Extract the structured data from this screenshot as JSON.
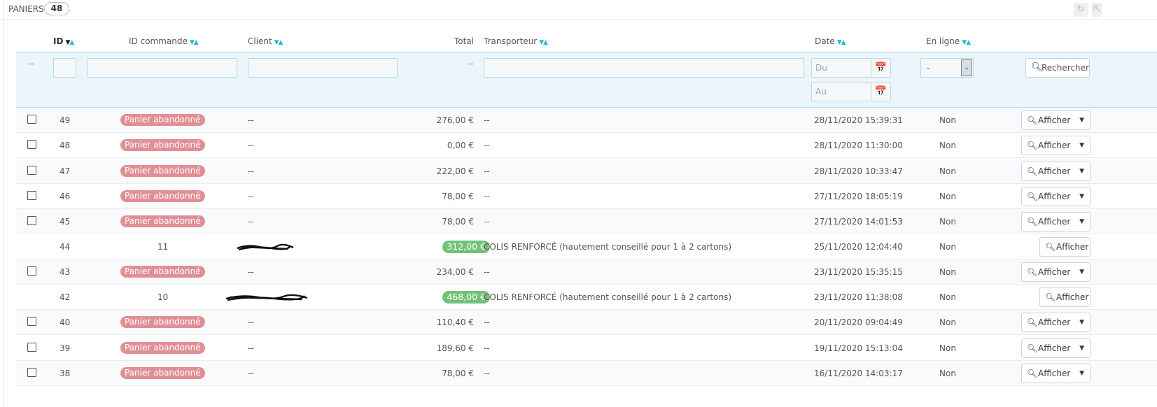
{
  "panel": {
    "title": "PANIERS",
    "count": "48"
  },
  "toolbar": {
    "refresh_icon": "refresh-icon",
    "export_icon": "export-icon"
  },
  "columns": {
    "id": "ID",
    "order_id": "ID commande",
    "client": "Client",
    "total": "Total",
    "carrier": "Transporteur",
    "date": "Date",
    "online": "En ligne"
  },
  "filters": {
    "id_dash": "--",
    "total_dash": "--",
    "date_from_placeholder": "Du",
    "date_to_placeholder": "Au",
    "online_value": "-",
    "search_label": "Rechercher"
  },
  "colors": {
    "accent": "#25b9d7",
    "abandoned": "#e08f95",
    "paid": "#72c279"
  },
  "rows": [
    {
      "id": "49",
      "order": "Panier abandonné",
      "client": "--",
      "total": "276,00 €",
      "carrier": "--",
      "date": "28/11/2020 15:39:31",
      "online": "Non",
      "action": "Afficher"
    },
    {
      "id": "48",
      "order": "Panier abandonné",
      "client": "--",
      "total": "0,00 €",
      "carrier": "--",
      "date": "28/11/2020 11:30:00",
      "online": "Non",
      "action": "Afficher"
    },
    {
      "id": "47",
      "order": "Panier abandonné",
      "client": "--",
      "total": "222,00 €",
      "carrier": "--",
      "date": "28/11/2020 10:33:47",
      "online": "Non",
      "action": "Afficher"
    },
    {
      "id": "46",
      "order": "Panier abandonné",
      "client": "--",
      "total": "78,00 €",
      "carrier": "--",
      "date": "27/11/2020 18:05:19",
      "online": "Non",
      "action": "Afficher"
    },
    {
      "id": "45",
      "order": "Panier abandonné",
      "client": "--",
      "total": "78,00 €",
      "carrier": "--",
      "date": "27/11/2020 14:01:53",
      "online": "Non",
      "action": "Afficher"
    },
    {
      "id": "44",
      "order": "11",
      "client": "",
      "total": "312,00 €",
      "carrier": "COLIS RENFORCÉ (hautement conseillé pour 1 à 2 cartons)",
      "date": "25/11/2020 12:04:40",
      "online": "Non",
      "action": "Afficher"
    },
    {
      "id": "43",
      "order": "Panier abandonné",
      "client": "--",
      "total": "234,00 €",
      "carrier": "--",
      "date": "23/11/2020 15:35:15",
      "online": "Non",
      "action": "Afficher"
    },
    {
      "id": "42",
      "order": "10",
      "client": "",
      "total": "468,00 €",
      "carrier": "COLIS RENFORCÉ (hautement conseillé pour 1 à 2 cartons)",
      "date": "23/11/2020 11:38:08",
      "online": "Non",
      "action": "Afficher"
    },
    {
      "id": "40",
      "order": "Panier abandonné",
      "client": "--",
      "total": "110,40 €",
      "carrier": "--",
      "date": "20/11/2020 09:04:49",
      "online": "Non",
      "action": "Afficher"
    },
    {
      "id": "39",
      "order": "Panier abandonné",
      "client": "--",
      "total": "189,60 €",
      "carrier": "--",
      "date": "19/11/2020 15:13:04",
      "online": "Non",
      "action": "Afficher"
    },
    {
      "id": "38",
      "order": "Panier abandonné",
      "client": "--",
      "total": "78,00 €",
      "carrier": "--",
      "date": "16/11/2020 14:03:17",
      "online": "Non",
      "action": "Afficher"
    }
  ]
}
